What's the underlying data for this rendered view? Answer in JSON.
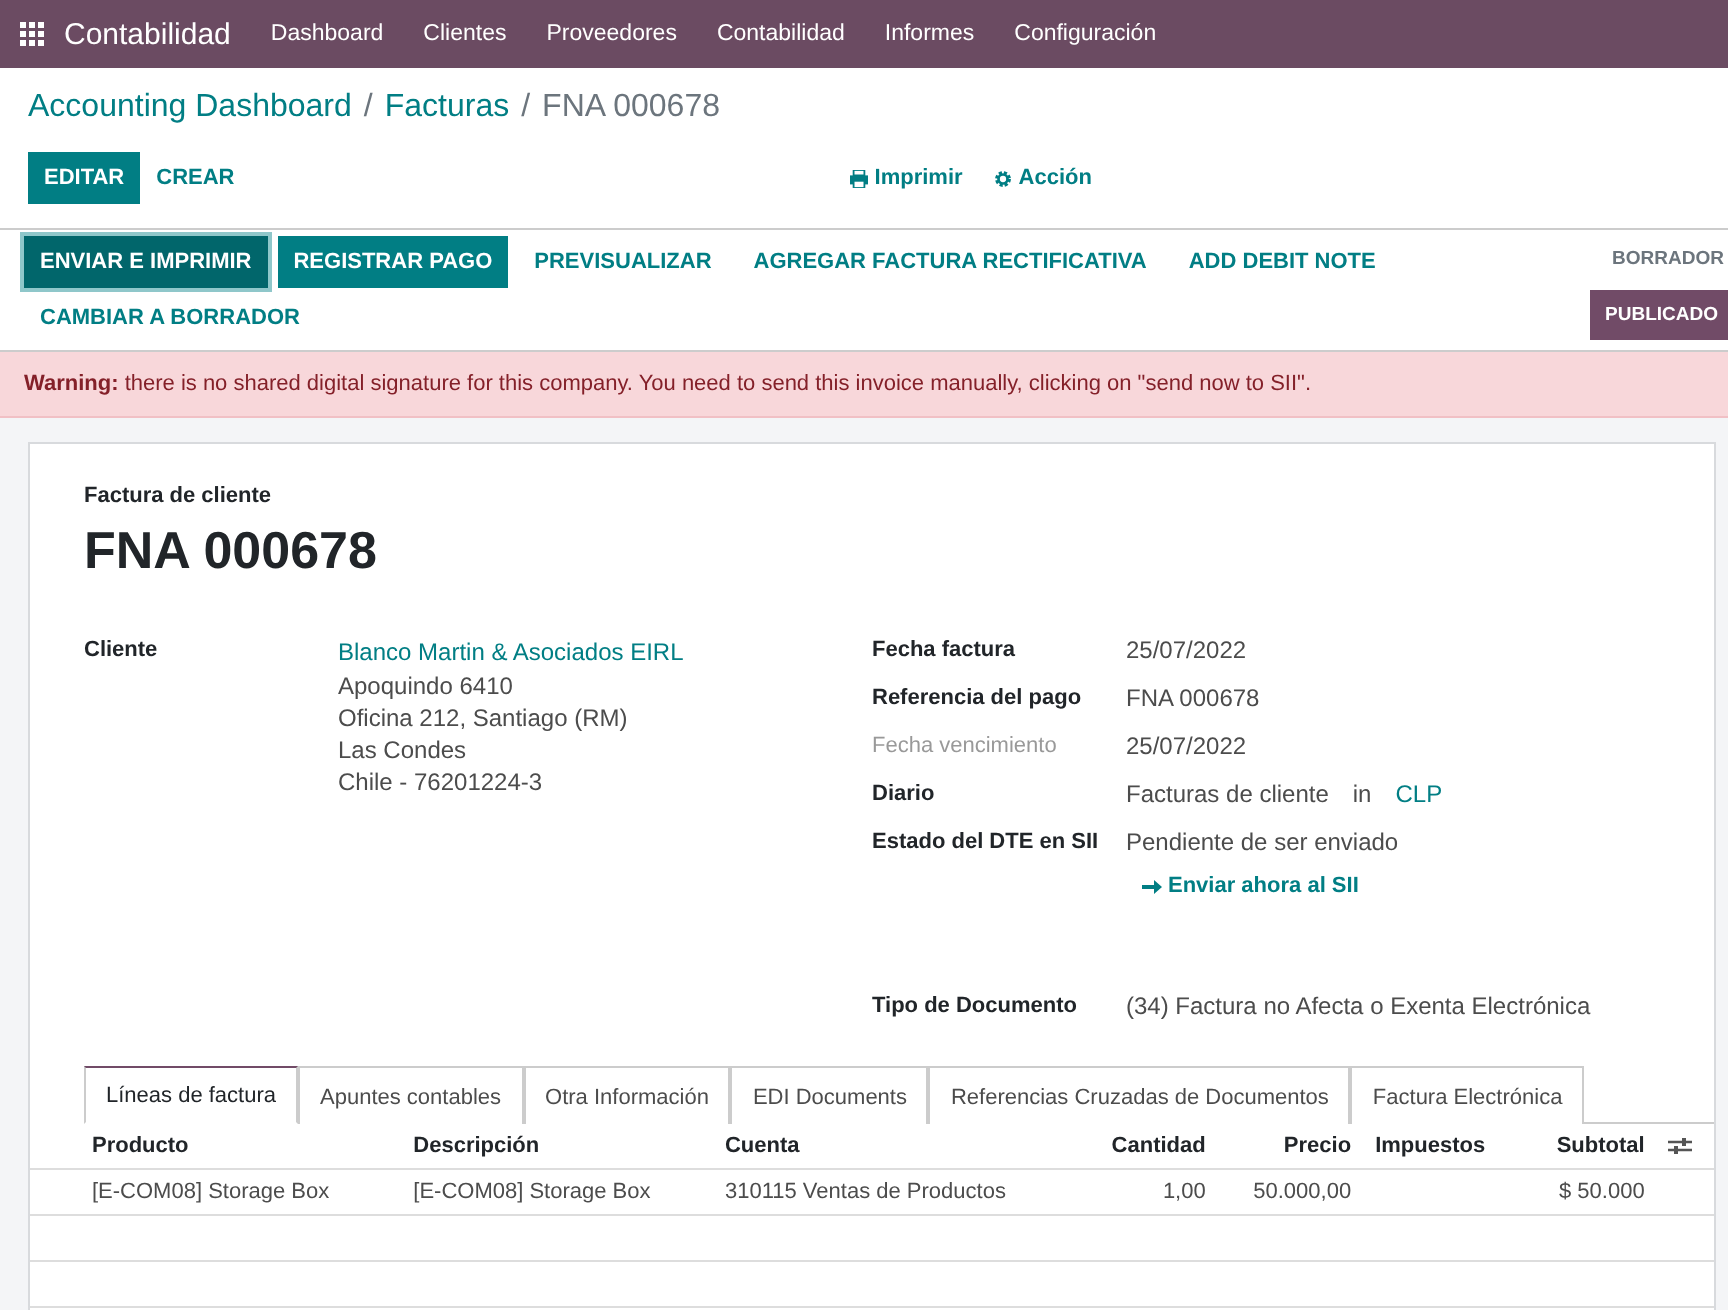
{
  "navbar": {
    "app_title": "Contabilidad",
    "menu": [
      "Dashboard",
      "Clientes",
      "Proveedores",
      "Contabilidad",
      "Informes",
      "Configuración"
    ]
  },
  "breadcrumb": [
    {
      "kind": "link",
      "label": "Accounting Dashboard"
    },
    {
      "kind": "separator",
      "label": "/"
    },
    {
      "kind": "link",
      "label": "Facturas"
    },
    {
      "kind": "separator",
      "label": "/"
    },
    {
      "kind": "current",
      "label": "FNA 000678"
    }
  ],
  "control_panel": {
    "buttons": [
      {
        "label": "EDITAR",
        "kind": "primary"
      },
      {
        "label": "CREAR",
        "kind": "link"
      }
    ],
    "actions": [
      {
        "label": "Imprimir",
        "kind": "print"
      },
      {
        "label": "Acción",
        "kind": "gear"
      }
    ]
  },
  "header_buttons": [
    {
      "label": "ENVIAR E IMPRIMIR",
      "kind": "primary",
      "focused": true
    },
    {
      "label": "REGISTRAR PAGO",
      "kind": "primary",
      "focused": false
    },
    {
      "label": "PREVISUALIZAR",
      "kind": "link",
      "focused": false
    },
    {
      "label": "AGREGAR FACTURA RECTIFICATIVA",
      "kind": "link",
      "focused": false
    },
    {
      "label": "ADD DEBIT NOTE",
      "kind": "link",
      "focused": false
    },
    {
      "label": "CAMBIAR A BORRADOR",
      "kind": "link",
      "focused": false
    }
  ],
  "statusbar": [
    {
      "label": "BORRADOR",
      "selected": false
    },
    {
      "label": "PUBLICADO",
      "selected": true
    }
  ],
  "warning": {
    "title": "Warning:",
    "text": "there is no shared digital signature for this company. You need to send this invoice manually, clicking on \"send now to SII\"."
  },
  "sheet": {
    "subtitle": "Factura de cliente",
    "name": "FNA 000678",
    "customer": {
      "label": "Cliente",
      "name": "Blanco Martin & Asociados EIRL",
      "address": [
        "Apoquindo 6410",
        "Oficina 212, Santiago (RM)",
        "Las Condes",
        "Chile - 76201224-3"
      ]
    },
    "fields": [
      {
        "kind": "text",
        "label": "Fecha factura",
        "muted": false,
        "value": "25/07/2022"
      },
      {
        "kind": "text",
        "label": "Referencia del pago",
        "muted": false,
        "value": "FNA 000678"
      },
      {
        "kind": "text",
        "label": "Fecha vencimiento",
        "muted": true,
        "value": "25/07/2022"
      },
      {
        "kind": "currency",
        "label": "Diario",
        "muted": false,
        "value": "Facturas de cliente",
        "joiner": "in",
        "currency": "CLP"
      },
      {
        "kind": "action",
        "label": "Estado del DTE en SII",
        "muted": false,
        "value": "Pendiente de ser enviado",
        "action": "Enviar ahora al SII"
      },
      {
        "kind": "spaced",
        "label": "Tipo de Documento",
        "muted": false,
        "value": "(34) Factura no Afecta o Exenta Electrónica"
      }
    ],
    "tabs": [
      {
        "label": "Líneas de factura",
        "selected": true
      },
      {
        "label": "Apuntes contables",
        "selected": false
      },
      {
        "label": "Otra Información",
        "selected": false
      },
      {
        "label": "EDI Documents",
        "selected": false
      },
      {
        "label": "Referencias Cruzadas de Documentos",
        "selected": false
      },
      {
        "label": "Factura Electrónica",
        "selected": false
      }
    ],
    "table": {
      "columns": [
        {
          "label": "Producto",
          "kind": "text"
        },
        {
          "label": "Descripción",
          "kind": "text"
        },
        {
          "label": "Cuenta",
          "kind": "text"
        },
        {
          "label": "Cantidad",
          "kind": "number"
        },
        {
          "label": "Precio",
          "kind": "number"
        },
        {
          "label": "Impuestos",
          "kind": "text"
        },
        {
          "label": "Subtotal",
          "kind": "number"
        }
      ],
      "rows": [
        [
          "[E-COM08] Storage Box",
          "[E-COM08] Storage Box",
          "310115 Ventas de Productos",
          "1,00",
          "50.000,00",
          "",
          "$ 50.000"
        ]
      ]
    }
  }
}
